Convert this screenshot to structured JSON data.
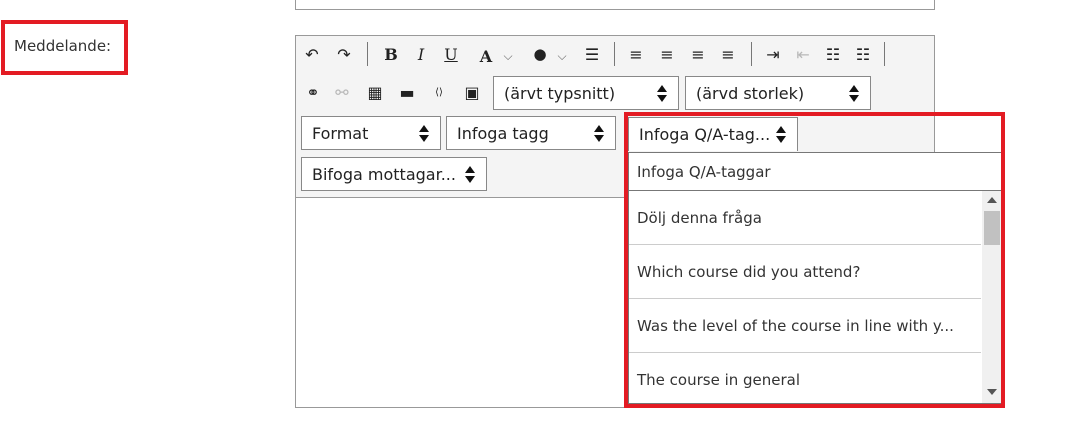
{
  "form": {
    "message_label": "Meddelande:"
  },
  "toolbar": {
    "icons": [
      "undo-icon",
      "redo-icon",
      "bold-icon",
      "italic-icon",
      "underline-icon",
      "font-color-icon",
      "background-color-icon",
      "clear-formatting-icon",
      "align-left-icon",
      "align-center-icon",
      "align-right-icon",
      "align-justify-icon",
      "indent-icon",
      "outdent-icon",
      "numbered-list-icon",
      "bulleted-list-icon",
      "link-icon",
      "unlink-icon",
      "table-icon",
      "horizontal-rule-icon",
      "source-code-icon",
      "image-icon"
    ],
    "glyphs": {
      "undo": "↶",
      "redo": "↷",
      "bold": "B",
      "italic": "I",
      "underline": "U",
      "font_color": "A",
      "background_color": "●",
      "clear_formatting": "☰",
      "align_left": "≡",
      "align_center": "≡",
      "align_right": "≡",
      "align_justify": "≡",
      "indent": "⇥",
      "outdent": "⇤",
      "numbered_list": "☷",
      "bulleted_list": "☷",
      "link": "⚭",
      "unlink": "⚯",
      "table": "▦",
      "horizontal_rule": "▬",
      "source_code": "⟨⟩",
      "image": "▣",
      "dropdown_caret": "⌵"
    },
    "font_family_select": "(ärvt typsnitt)",
    "font_size_select": "(ärvd storlek)",
    "format_select": "Format",
    "insert_tag_select": "Infoga tagg",
    "insert_qa_tags_select": "Infoga Q/A-tag...",
    "attach_recipient_select": "Bifoga mottagar..."
  },
  "qa_dropdown": {
    "header": "Infoga Q/A-taggar",
    "options": [
      "Dölj denna fråga",
      "Which course did you attend?",
      "Was the level of the course in line with y...",
      "The course in general"
    ]
  },
  "colors": {
    "highlight": "#e31b23",
    "toolbar_bg": "#f4f4f4",
    "border": "#999999"
  }
}
